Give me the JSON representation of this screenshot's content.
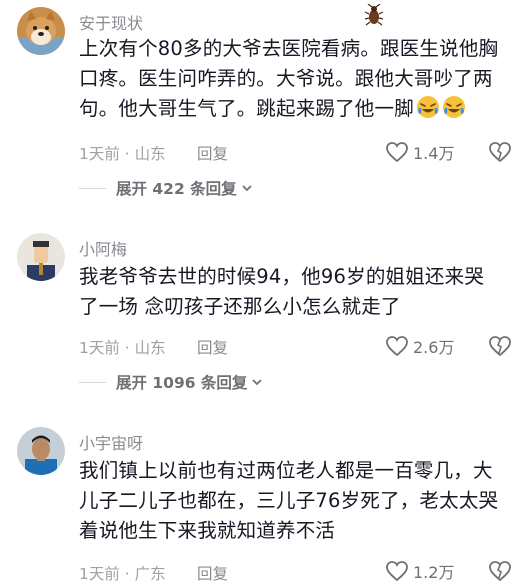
{
  "comments": [
    {
      "username": "安于现状",
      "text_lines": [
        "上次有个80多的大爷去医院看病。跟医生说他胸",
        "口疼。医生问咋弄的。大爷说。跟他大哥吵了两",
        "句。他大哥生气了。跳起来踢了他一脚"
      ],
      "emojis": [
        "laughing-tears-emoji",
        "laughing-tears-emoji"
      ],
      "time_location": "1天前 · 山东",
      "reply_label": "回复",
      "likes": "1.4万",
      "expand_label": "展开 422 条回复",
      "avatar": "dog-avatar"
    },
    {
      "username": "小阿梅",
      "text_lines": [
        "我老爷爷去世的时候94，他96岁的姐姐还来哭",
        "了一场 念叨孩子还那么小怎么就走了"
      ],
      "time_location": "1天前 · 山东",
      "reply_label": "回复",
      "likes": "2.6万",
      "expand_label": "展开 1096 条回复",
      "avatar": "cartoon-man-avatar"
    },
    {
      "username": "小宇宙呀",
      "text_lines": [
        "我们镇上以前也有过两位老人都是一百零几，大",
        "儿子二儿子也都在，三儿子76岁死了，老太太哭",
        "着说他生下来我就知道养不活"
      ],
      "time_location": "1天前 · 广东",
      "reply_label": "回复",
      "likes": "1.2万",
      "avatar": "photo-man-avatar"
    }
  ],
  "icons": {
    "like": "heart-outline-icon",
    "dislike": "broken-heart-icon",
    "expand": "chevron-down-icon",
    "decor": "cockroach-icon"
  }
}
